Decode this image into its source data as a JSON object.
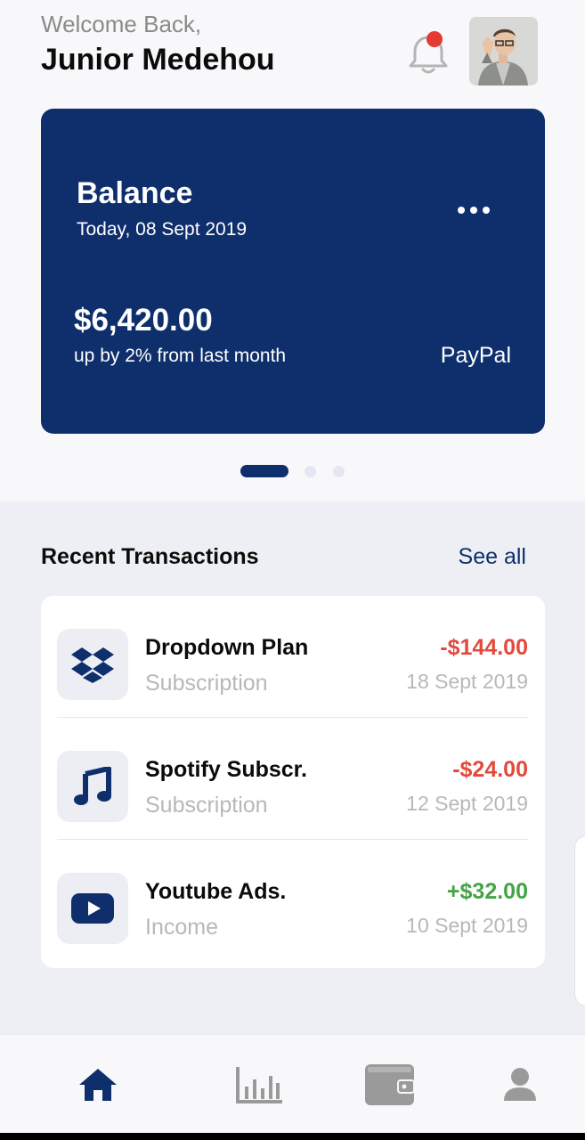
{
  "header": {
    "greeting": "Welcome Back,",
    "user_name": "Junior Medehou"
  },
  "balance_card": {
    "title": "Balance",
    "date": "Today, 08 Sept 2019",
    "amount": "$6,420.00",
    "change_text": "up by 2% from last month",
    "provider": "PayPal",
    "carousel_active_index": 0,
    "carousel_count": 3
  },
  "transactions": {
    "section_title": "Recent Transactions",
    "see_all_label": "See all",
    "items": [
      {
        "name": "Dropdown Plan",
        "category": "Subscription",
        "amount": "-$144.00",
        "date": "18 Sept 2019",
        "icon": "dropbox-icon",
        "amount_color": "#e34a3c"
      },
      {
        "name": "Spotify Subscr.",
        "category": "Subscription",
        "amount": "-$24.00",
        "date": "12 Sept 2019",
        "icon": "music-note-icon",
        "amount_color": "#e34a3c"
      },
      {
        "name": "Youtube Ads.",
        "category": "Income",
        "amount": "+$32.00",
        "date": "10 Sept 2019",
        "icon": "youtube-icon",
        "amount_color": "#43a447"
      }
    ]
  },
  "bottom_nav": {
    "items": [
      {
        "icon": "home-icon",
        "active": true
      },
      {
        "icon": "bar-chart-icon",
        "active": false
      },
      {
        "icon": "wallet-icon",
        "active": false
      },
      {
        "icon": "profile-icon",
        "active": false
      }
    ]
  },
  "colors": {
    "primary": "#0f2f6c",
    "negative": "#e34a3c",
    "positive": "#43a447",
    "notification": "#e53935",
    "muted": "#b8b8b8"
  }
}
